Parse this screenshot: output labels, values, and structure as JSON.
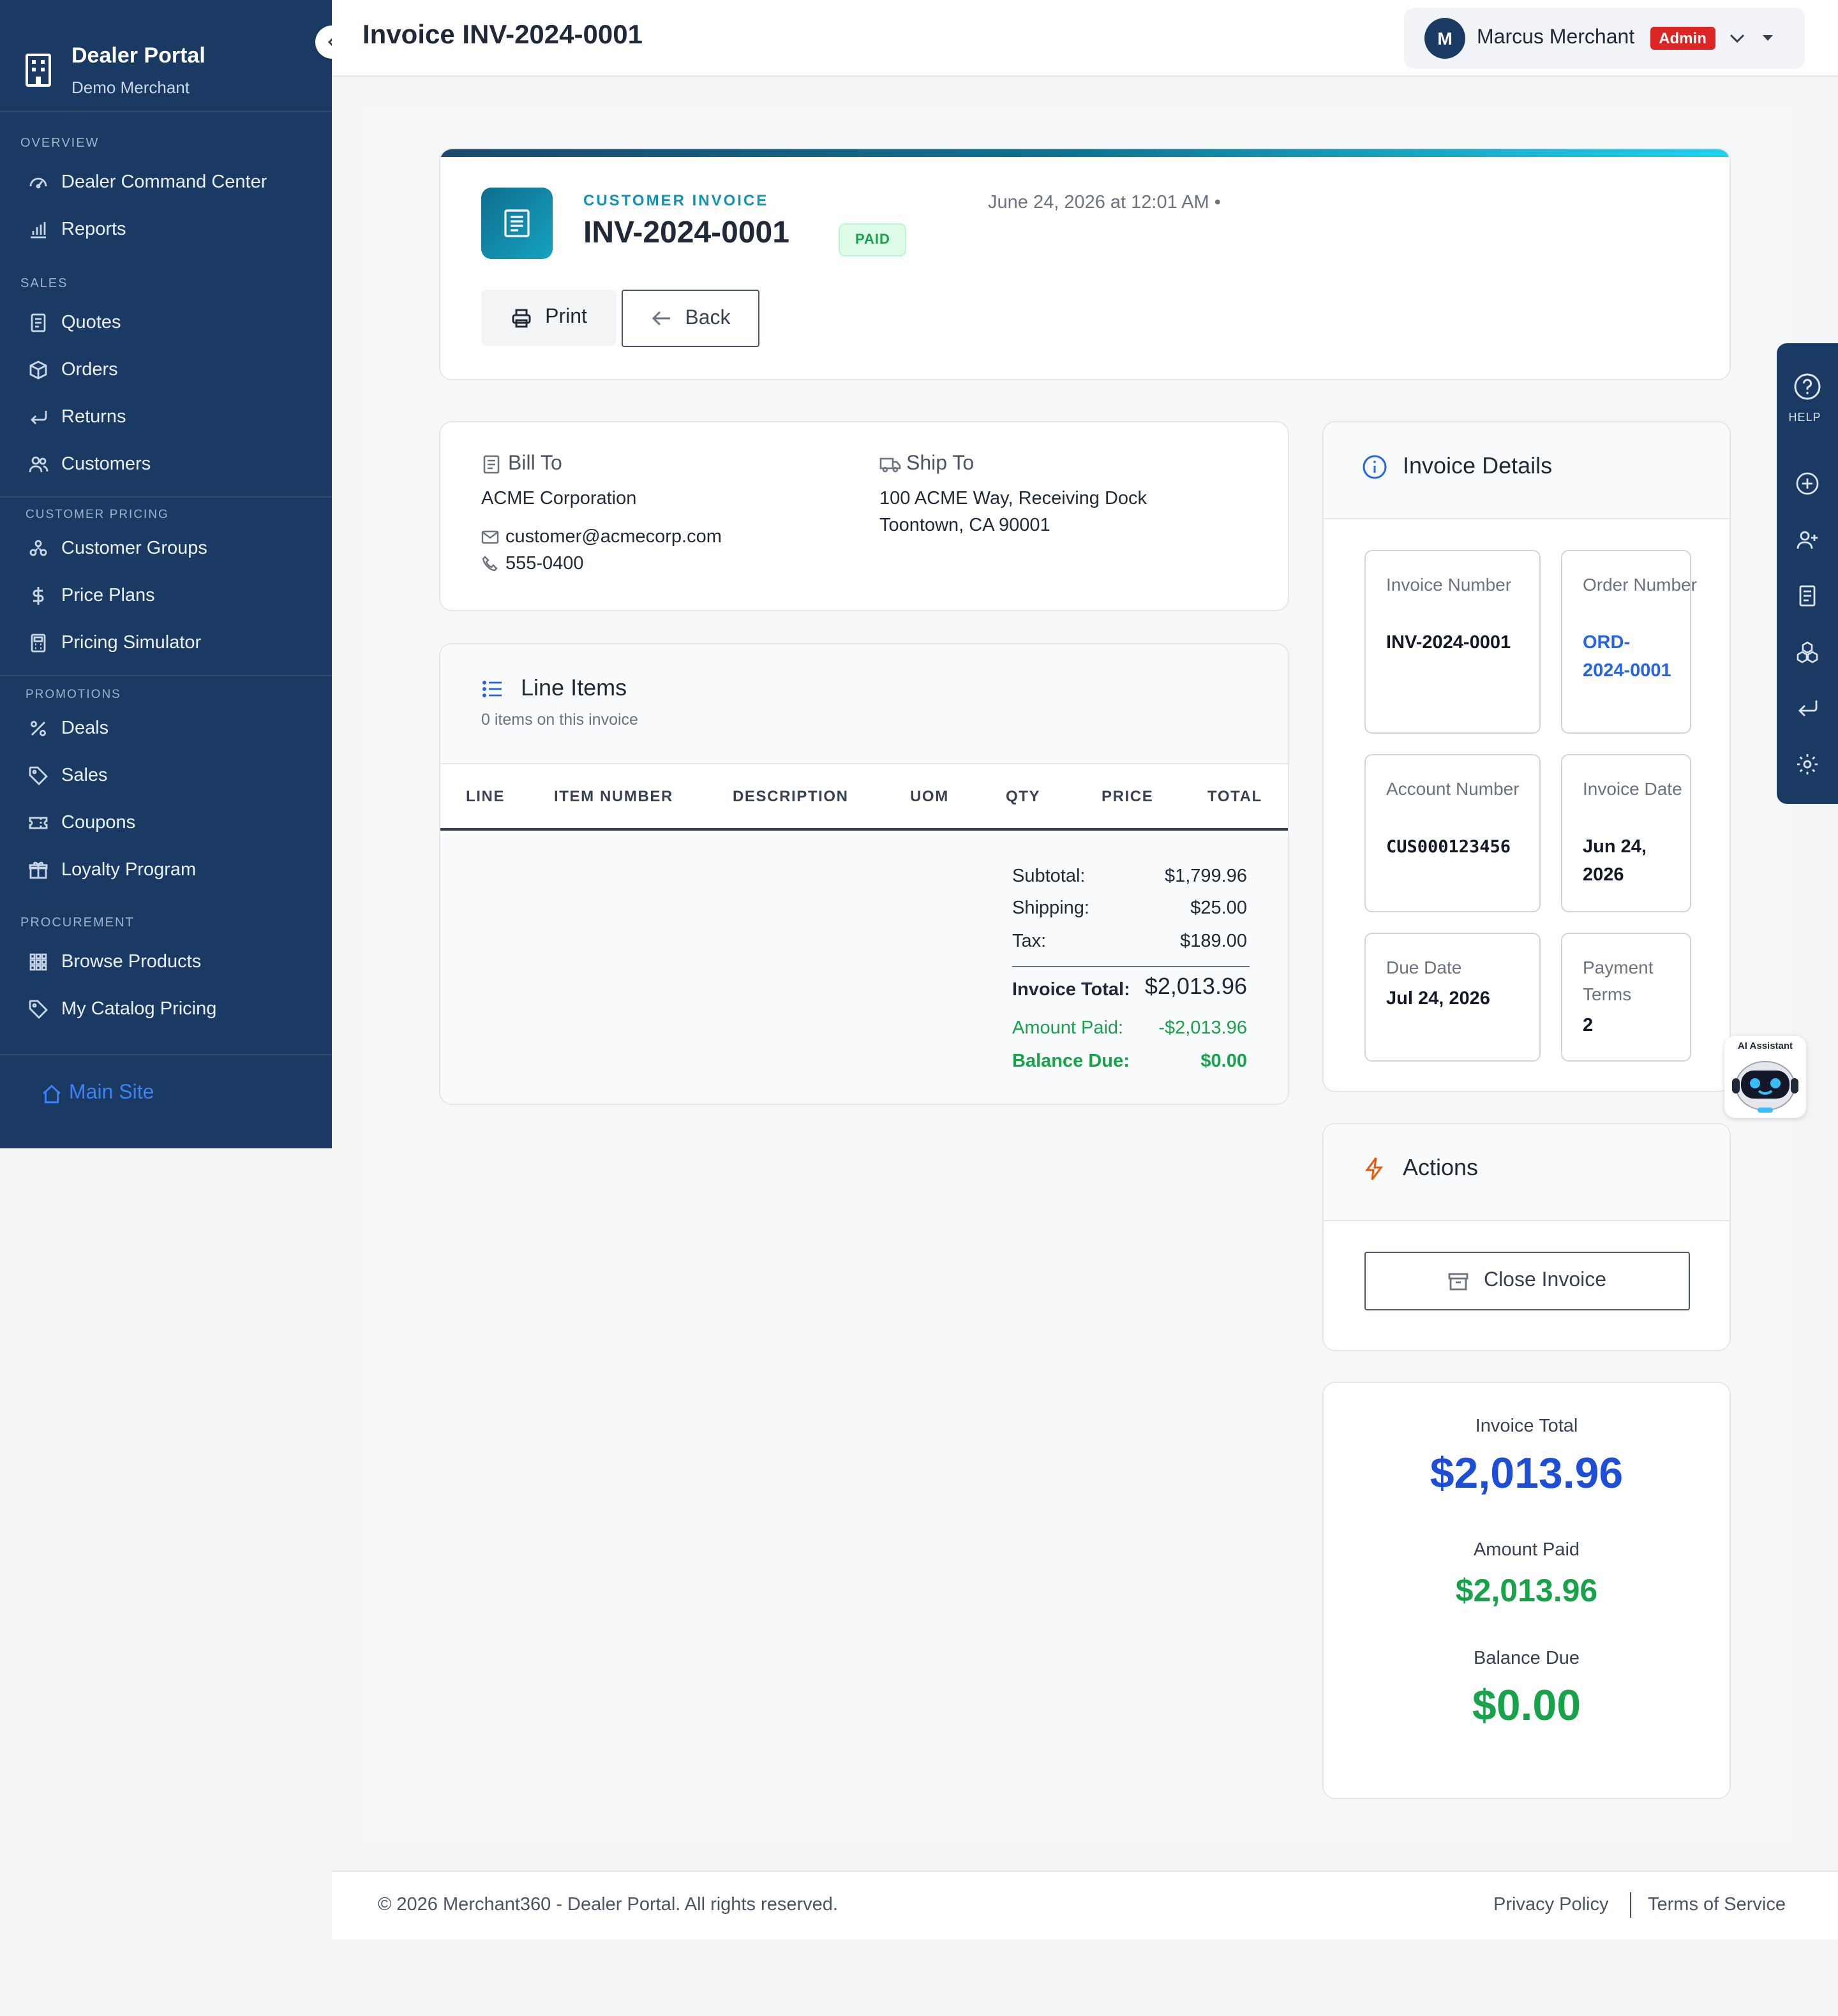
{
  "sidebar": {
    "title": "Dealer Portal",
    "subtitle": "Demo Merchant",
    "sections": {
      "overview": "OVERVIEW",
      "sales": "SALES",
      "customer_pricing": "CUSTOMER PRICING",
      "promotions": "PROMOTIONS",
      "procurement": "PROCUREMENT"
    },
    "items": {
      "command_center": "Dealer Command Center",
      "reports": "Reports",
      "quotes": "Quotes",
      "orders": "Orders",
      "returns": "Returns",
      "customers": "Customers",
      "customer_groups": "Customer Groups",
      "price_plans": "Price Plans",
      "pricing_simulator": "Pricing Simulator",
      "deals": "Deals",
      "sales": "Sales",
      "coupons": "Coupons",
      "loyalty": "Loyalty Program",
      "browse_products": "Browse Products",
      "catalog_pricing": "My Catalog Pricing"
    },
    "main_site": "Main Site"
  },
  "topbar": {
    "title": "Invoice INV-2024-0001",
    "user_initial": "M",
    "user_name": "Marcus Merchant",
    "role_badge": "Admin"
  },
  "invoice_header": {
    "eyebrow": "CUSTOMER INVOICE",
    "number": "INV-2024-0001",
    "status": "PAID",
    "date": "June 24, 2026 at 12:01 AM •",
    "print_label": "Print",
    "back_label": "Back"
  },
  "bill_to": {
    "title": "Bill To",
    "company": "ACME Corporation",
    "email": "customer@acmecorp.com",
    "phone": "555-0400"
  },
  "ship_to": {
    "title": "Ship To",
    "line1": "100 ACME Way, Receiving Dock",
    "line2": "Toontown, CA 90001"
  },
  "line_items": {
    "title": "Line Items",
    "subtitle": "0 items on this invoice",
    "columns": [
      "LINE",
      "ITEM NUMBER",
      "DESCRIPTION",
      "UOM",
      "QTY",
      "PRICE",
      "TOTAL"
    ],
    "totals": {
      "subtotal_label": "Subtotal:",
      "subtotal": "$1,799.96",
      "shipping_label": "Shipping:",
      "shipping": "$25.00",
      "tax_label": "Tax:",
      "tax": "$189.00",
      "invoice_total_label": "Invoice Total:",
      "invoice_total": "$2,013.96",
      "amount_paid_label": "Amount Paid:",
      "amount_paid": "-$2,013.96",
      "balance_due_label": "Balance Due:",
      "balance_due": "$0.00"
    }
  },
  "details": {
    "title": "Invoice Details",
    "invoice_number_label": "Invoice Number",
    "invoice_number": "INV-2024-0001",
    "order_number_label": "Order Number",
    "order_number": "ORD-2024-0001",
    "account_number_label": "Account Number",
    "account_number": "CUS000123456",
    "invoice_date_label": "Invoice Date",
    "invoice_date": "Jun 24, 2026",
    "due_date_label": "Due Date",
    "due_date": "Jul 24, 2026",
    "payment_terms_label": "Payment Terms",
    "payment_terms": "2"
  },
  "actions": {
    "title": "Actions",
    "close_label": "Close Invoice"
  },
  "summary": {
    "invoice_total_label": "Invoice Total",
    "invoice_total": "$2,013.96",
    "amount_paid_label": "Amount Paid",
    "amount_paid": "$2,013.96",
    "balance_due_label": "Balance Due",
    "balance_due": "$0.00"
  },
  "help_rail": {
    "help_label": "HELP"
  },
  "ai_assistant": {
    "label": "AI Assistant"
  },
  "footer": {
    "copyright": "© 2026 Merchant360 - Dealer Portal. All rights reserved.",
    "privacy": "Privacy Policy",
    "terms": "Terms of Service"
  },
  "colors": {
    "sidebar_bg": "#1b3a63",
    "accent_blue": "#2563eb",
    "accent_teal": "#0e93b0",
    "success_green": "#16a34a",
    "danger_red": "#dc2626"
  }
}
